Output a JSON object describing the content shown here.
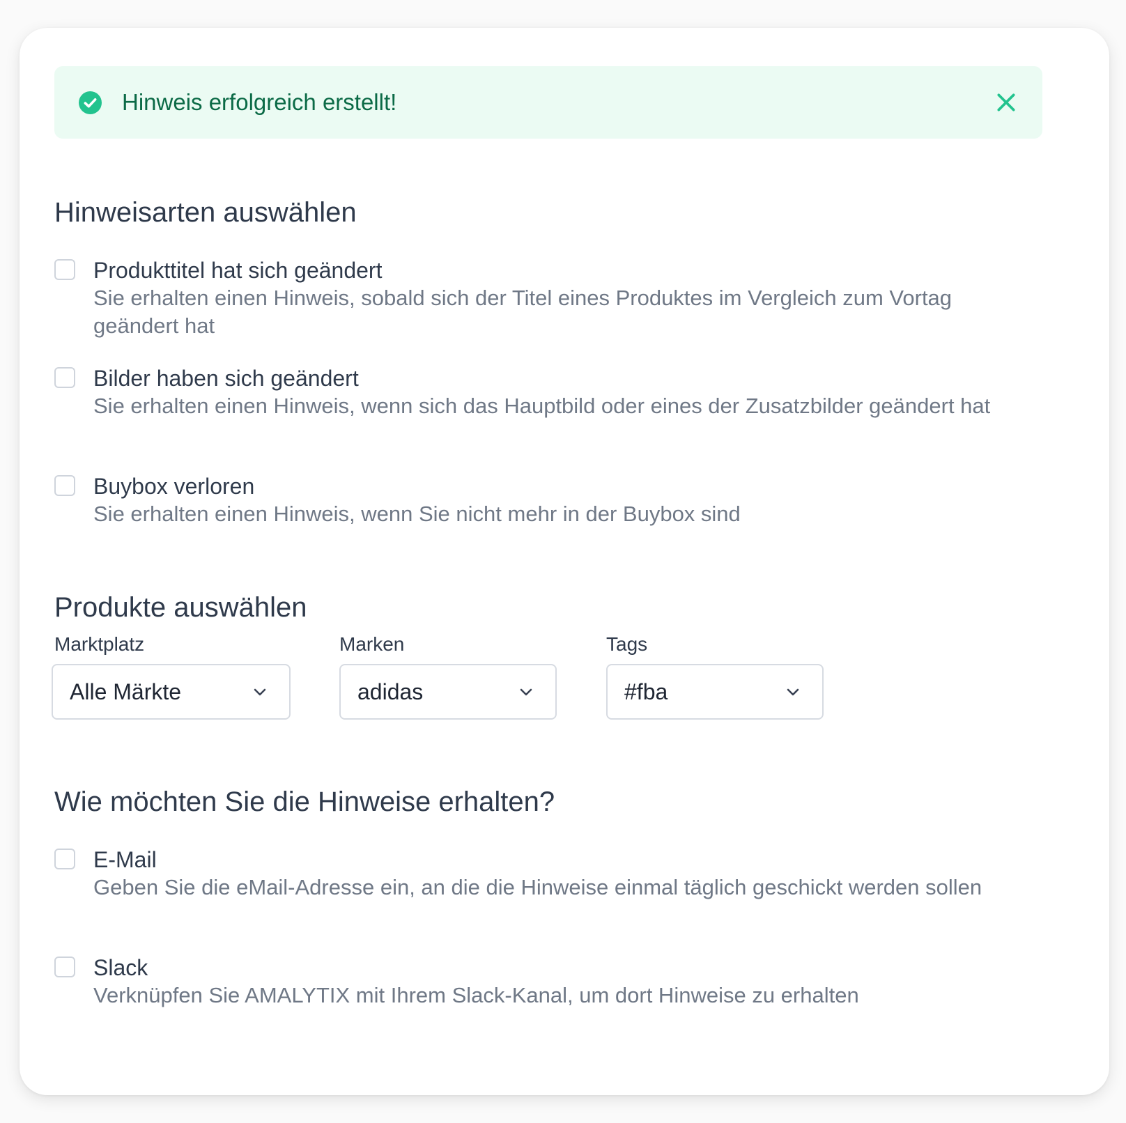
{
  "alert": {
    "message": "Hinweis erfolgreich erstellt!",
    "color": "#0b6a46",
    "icon": "check-circle-icon",
    "close_icon": "close-icon"
  },
  "notification_types": {
    "heading": "Hinweisarten auswählen",
    "options": [
      {
        "title": "Produkttitel hat sich geändert",
        "description": "Sie erhalten einen Hinweis, sobald sich der Titel eines Produktes im Vergleich zum Vortag geändert hat",
        "checked": false
      },
      {
        "title": "Bilder haben sich geändert",
        "description": "Sie erhalten einen Hinweis, wenn sich das Hauptbild oder eines der Zusatzbilder geändert hat",
        "checked": false
      },
      {
        "title": "Buybox verloren",
        "description": "Sie erhalten einen Hinweis, wenn Sie nicht mehr in der Buybox sind",
        "checked": false
      }
    ]
  },
  "products": {
    "heading": "Produkte auswählen",
    "filters": [
      {
        "label": "Marktplatz",
        "value": "Alle Märkte"
      },
      {
        "label": "Marken",
        "value": "adidas"
      },
      {
        "label": "Tags",
        "value": "#fba"
      }
    ]
  },
  "delivery": {
    "heading": "Wie möchten Sie die Hinweise erhalten?",
    "options": [
      {
        "title": "E-Mail",
        "description": "Geben Sie die eMail-Adresse ein, an die die Hinweise einmal täglich geschickt werden sollen",
        "checked": false
      },
      {
        "title": "Slack",
        "description": "Verknüpfen Sie AMALYTIX mit Ihrem Slack-Kanal, um dort Hinweise zu erhalten",
        "checked": false
      }
    ]
  },
  "colors": {
    "accent_green": "#22c38e",
    "heading": "#2f3a4b",
    "muted": "#6f7886",
    "alert_bg": "#ebfbf3"
  }
}
